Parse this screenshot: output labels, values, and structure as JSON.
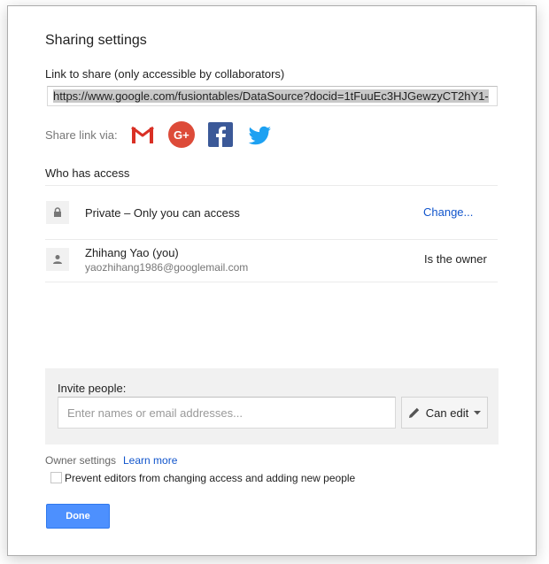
{
  "dialog": {
    "title": "Sharing settings",
    "link_label": "Link to share (only accessible by collaborators)",
    "link_url": "https://www.google.com/fusiontables/DataSource?docid=1tFuuEc3HJGewzyCT2hY1-",
    "share_via_label": "Share link via:",
    "share_icons": [
      "gmail-icon",
      "google-plus-icon",
      "facebook-icon",
      "twitter-icon"
    ],
    "who_has_access_label": "Who has access",
    "access_rows": [
      {
        "icon": "lock-icon",
        "text": "Private – Only you can access",
        "action": "Change..."
      },
      {
        "icon": "person-icon",
        "name": "Zhihang Yao (you)",
        "email": "yaozhihang1986@googlemail.com",
        "role": "Is the owner"
      }
    ],
    "invite": {
      "label": "Invite people:",
      "placeholder": "Enter names or email addresses...",
      "permission": "Can edit"
    },
    "owner_settings_label": "Owner settings",
    "learn_more": "Learn more",
    "prevent_editors_label": "Prevent editors from changing access and adding new people",
    "done_label": "Done"
  },
  "colors": {
    "link": "#1155cc",
    "primary_button": "#4d90fe",
    "gmail_red": "#d93025",
    "google_plus_red": "#dd4b39",
    "facebook_blue": "#3b5998",
    "twitter_blue": "#1da1f2"
  }
}
